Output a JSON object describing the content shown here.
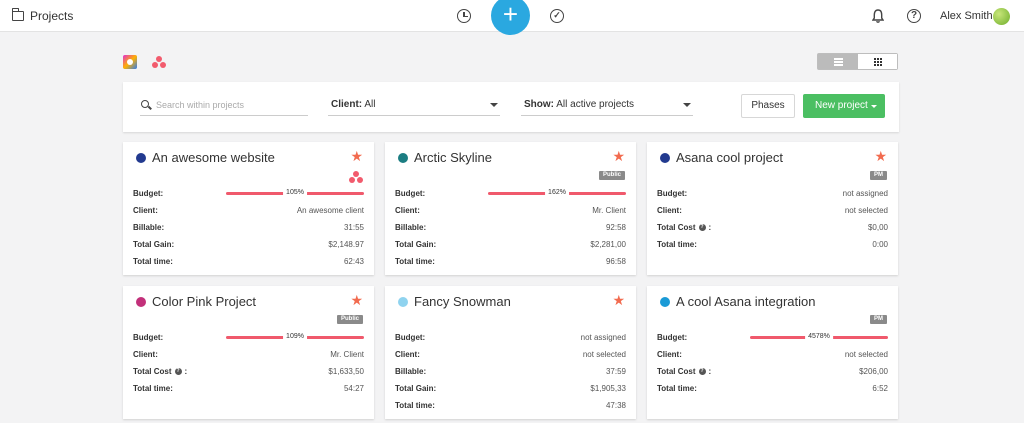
{
  "header": {
    "title": "Projects",
    "user_name": "Alex Smith"
  },
  "filters": {
    "search_placeholder": "Search within projects",
    "client_label": "Client:",
    "client_value": "All",
    "show_label": "Show:",
    "show_value": "All active projects",
    "phases_label": "Phases",
    "new_project_label": "New project"
  },
  "projects": [
    {
      "name": "An awesome website",
      "color": "#223a8f",
      "starred": true,
      "badge": "",
      "asana": true,
      "rows": [
        {
          "label": "Budget:",
          "bar": true,
          "percent": "105%"
        },
        {
          "label": "Client:",
          "value": "An awesome client"
        },
        {
          "label": "Billable:",
          "value": "31:55"
        },
        {
          "label": "Total Gain:",
          "value": "$2,148.97"
        },
        {
          "label": "Total time:",
          "value": "62:43"
        }
      ]
    },
    {
      "name": "Arctic Skyline",
      "color": "#1b7d82",
      "starred": true,
      "badge": "Public",
      "asana": false,
      "rows": [
        {
          "label": "Budget:",
          "bar": true,
          "percent": "162%"
        },
        {
          "label": "Client:",
          "value": "Mr. Client"
        },
        {
          "label": "Billable:",
          "value": "92:58"
        },
        {
          "label": "Total Gain:",
          "value": "$2,281,00"
        },
        {
          "label": "Total time:",
          "value": "96:58"
        }
      ]
    },
    {
      "name": "Asana cool project",
      "color": "#223a8f",
      "starred": true,
      "badge": "PM",
      "asana": false,
      "rows": [
        {
          "label": "Budget:",
          "value": "not assigned"
        },
        {
          "label": "Client:",
          "value": "not selected"
        },
        {
          "label": "Total Cost",
          "info": true,
          "value": "$0,00"
        },
        {
          "label": "Total time:",
          "value": "0:00"
        }
      ]
    },
    {
      "name": "Color Pink Project",
      "color": "#c2307a",
      "starred": true,
      "badge": "Public",
      "asana": false,
      "rows": [
        {
          "label": "Budget:",
          "bar": true,
          "percent": "109%"
        },
        {
          "label": "Client:",
          "value": "Mr. Client"
        },
        {
          "label": "Total Cost",
          "info": true,
          "value": "$1,633,50"
        },
        {
          "label": "Total time:",
          "value": "54:27"
        }
      ]
    },
    {
      "name": "Fancy Snowman",
      "color": "#8fd3ef",
      "starred": true,
      "badge": "",
      "asana": false,
      "rows": [
        {
          "label": "Budget:",
          "value": "not assigned"
        },
        {
          "label": "Client:",
          "value": "not selected"
        },
        {
          "label": "Billable:",
          "value": "37:59"
        },
        {
          "label": "Total Gain:",
          "value": "$1,905,33"
        },
        {
          "label": "Total time:",
          "value": "47:38"
        }
      ]
    },
    {
      "name": "A cool Asana integration",
      "color": "#1a9ad6",
      "starred": false,
      "badge": "PM",
      "asana": false,
      "rows": [
        {
          "label": "Budget:",
          "bar": true,
          "percent": "4578%"
        },
        {
          "label": "Client:",
          "value": "not selected"
        },
        {
          "label": "Total Cost",
          "info": true,
          "value": "$206,00"
        },
        {
          "label": "Total time:",
          "value": "6:52"
        }
      ]
    }
  ]
}
